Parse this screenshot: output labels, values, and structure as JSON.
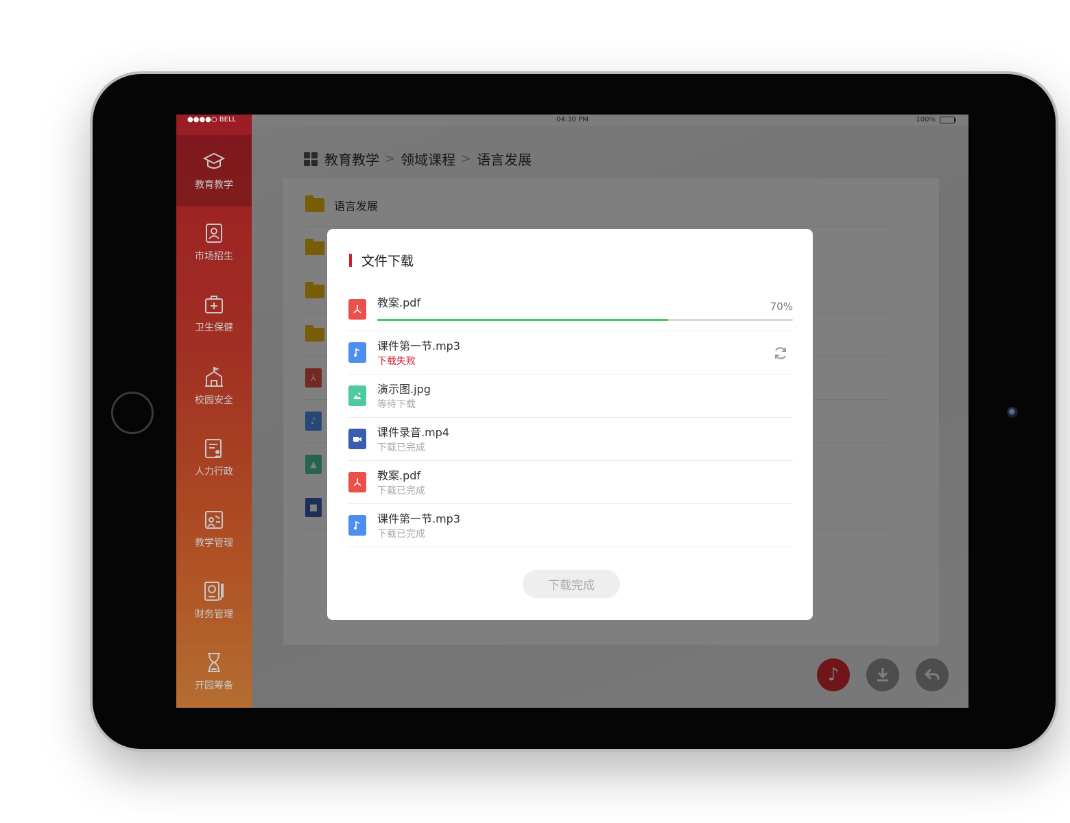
{
  "status_bar": {
    "carrier": "●●●●○ BELL",
    "time": "04:30  PM",
    "battery": "100%"
  },
  "sidebar": {
    "items": [
      {
        "label": "教育教学",
        "icon": "graduation-cap-icon"
      },
      {
        "label": "市场招生",
        "icon": "contact-card-icon"
      },
      {
        "label": "卫生保健",
        "icon": "medical-kit-icon"
      },
      {
        "label": "校园安全",
        "icon": "school-building-icon"
      },
      {
        "label": "人力行政",
        "icon": "staff-document-icon"
      },
      {
        "label": "教学管理",
        "icon": "teaching-board-icon"
      },
      {
        "label": "财务管理",
        "icon": "finance-ledger-icon"
      },
      {
        "label": "开园筹备",
        "icon": "hourglass-icon"
      }
    ]
  },
  "breadcrumb": {
    "items": [
      "教育教学",
      "领域课程",
      "语言发展"
    ],
    "separator": ">"
  },
  "file_list": {
    "first_folder": "语言发展"
  },
  "modal": {
    "title": "文件下载",
    "downloads": [
      {
        "name": "教案.pdf",
        "type": "pdf",
        "percent": "70%",
        "progress": 0.7
      },
      {
        "name": "课件第一节.mp3",
        "type": "audio",
        "status": "下载失败"
      },
      {
        "name": "演示图.jpg",
        "type": "image",
        "status": "等待下载"
      },
      {
        "name": "课件录音.mp4",
        "type": "video",
        "status": "下载已完成"
      },
      {
        "name": "教案.pdf",
        "type": "pdf",
        "status": "下载已完成"
      },
      {
        "name": "课件第一节.mp3",
        "type": "audio",
        "status": "下载已完成"
      }
    ],
    "button_label": "下载完成"
  },
  "colors": {
    "accent": "#d0202a",
    "pdf": "#e9514b",
    "audio": "#4f8ef0",
    "image": "#4ec9a0",
    "video": "#3a5db0",
    "progress": "#4cc25d",
    "folder": "#f3b80e"
  }
}
